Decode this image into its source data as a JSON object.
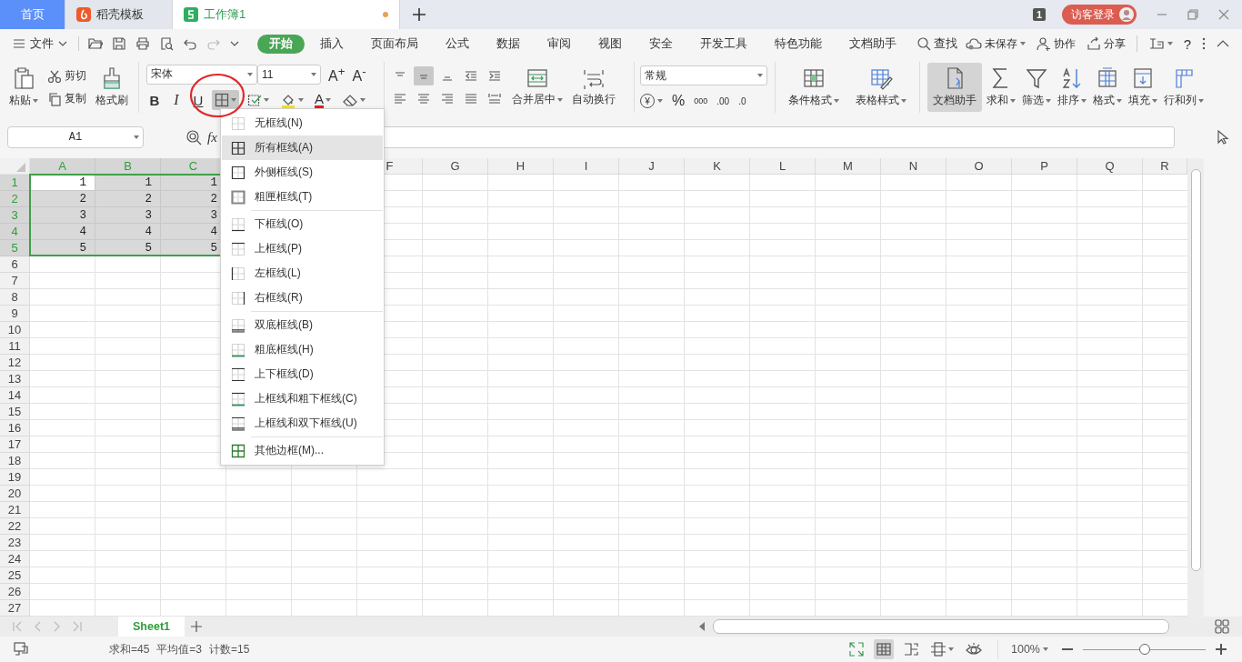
{
  "tab_bar": {
    "tabs": [
      {
        "label": "首页",
        "kind": "home",
        "selected": false,
        "modified": false
      },
      {
        "label": "稻壳模板",
        "kind": "docer",
        "selected": false,
        "modified": false
      },
      {
        "label": "工作簿1",
        "kind": "sheet",
        "selected": true,
        "modified": true
      }
    ],
    "window_count": "1",
    "login_button": "访客登录"
  },
  "menu_bar": {
    "file": "文件",
    "tabs": [
      {
        "label": "开始",
        "selected": true
      },
      {
        "label": "插入",
        "selected": false
      },
      {
        "label": "页面布局",
        "selected": false
      },
      {
        "label": "公式",
        "selected": false
      },
      {
        "label": "数据",
        "selected": false
      },
      {
        "label": "审阅",
        "selected": false
      },
      {
        "label": "视图",
        "selected": false
      },
      {
        "label": "安全",
        "selected": false
      },
      {
        "label": "开发工具",
        "selected": false
      },
      {
        "label": "特色功能",
        "selected": false
      },
      {
        "label": "文档助手",
        "selected": false
      }
    ],
    "search": "查找",
    "unsaved": "未保存",
    "collaborate": "协作",
    "share": "分享",
    "help": "?"
  },
  "ribbon": {
    "paste": "粘贴",
    "cut": "剪切",
    "copy": "复制",
    "format_painter": "格式刷",
    "font_name": "宋体",
    "font_size": "11",
    "grow_font": "A$^{+}$",
    "shrink_font": "A$^{-}$",
    "bold": "B",
    "italic": "I",
    "underline": "U",
    "font_color": "A",
    "border_menu_open": true,
    "align_buttons": [
      {
        "kind": "top",
        "selected": false
      },
      {
        "kind": "middle",
        "selected": true
      },
      {
        "kind": "bottom",
        "selected": false
      },
      {
        "kind": "outdent",
        "selected": false
      },
      {
        "kind": "indent",
        "selected": false
      },
      {
        "kind": "left",
        "selected": false
      },
      {
        "kind": "center",
        "selected": false
      },
      {
        "kind": "right",
        "selected": false
      },
      {
        "kind": "justify",
        "selected": false
      },
      {
        "kind": "distributed",
        "selected": false
      }
    ],
    "merge_center": "合并居中",
    "wrap_text": "自动换行",
    "number_format": "常规",
    "currency": "¥",
    "percent": "%",
    "thousands": "000",
    "add_decimal": ".00",
    "remove_decimal": ".0",
    "styles": [
      {
        "label": "条件格式",
        "kind": "conditional"
      },
      {
        "label": "表格样式",
        "kind": "table-style"
      }
    ],
    "tools": [
      {
        "label": "文档助手",
        "kind": "assistant",
        "selected": true
      },
      {
        "label": "求和",
        "kind": "sum",
        "selected": false
      },
      {
        "label": "筛选",
        "kind": "filter",
        "selected": false
      },
      {
        "label": "排序",
        "kind": "sort",
        "selected": false
      },
      {
        "label": "格式",
        "kind": "format",
        "selected": false
      },
      {
        "label": "填充",
        "kind": "fill",
        "selected": false
      },
      {
        "label": "行和列",
        "kind": "rowcol",
        "selected": false
      }
    ]
  },
  "formula_bar": {
    "cell_reference": "A1",
    "fx": "fx"
  },
  "sheet": {
    "column_groups": [
      [
        {
          "label": "A",
          "selected": true
        },
        {
          "label": "B",
          "selected": true
        },
        {
          "label": "C",
          "selected": true
        }
      ],
      [
        {
          "label": "F",
          "selected": false
        },
        {
          "label": "G",
          "selected": false
        },
        {
          "label": "H",
          "selected": false
        },
        {
          "label": "I",
          "selected": false
        },
        {
          "label": "J",
          "selected": false
        },
        {
          "label": "K",
          "selected": false
        },
        {
          "label": "L",
          "selected": false
        },
        {
          "label": "M",
          "selected": false
        },
        {
          "label": "N",
          "selected": false
        },
        {
          "label": "O",
          "selected": false
        },
        {
          "label": "P",
          "selected": false
        },
        {
          "label": "Q",
          "selected": false
        },
        {
          "label": "R",
          "selected": false
        }
      ]
    ],
    "rows": [
      {
        "label": "1",
        "selected": true,
        "cells": [
          {
            "value": "1",
            "active": true
          },
          {
            "value": "1",
            "active": false
          },
          {
            "value": "1",
            "active": false
          }
        ]
      },
      {
        "label": "2",
        "selected": true,
        "cells": [
          {
            "value": "2",
            "active": false
          },
          {
            "value": "2",
            "active": false
          },
          {
            "value": "2",
            "active": false
          }
        ]
      },
      {
        "label": "3",
        "selected": true,
        "cells": [
          {
            "value": "3",
            "active": false
          },
          {
            "value": "3",
            "active": false
          },
          {
            "value": "3",
            "active": false
          }
        ]
      },
      {
        "label": "4",
        "selected": true,
        "cells": [
          {
            "value": "4",
            "active": false
          },
          {
            "value": "4",
            "active": false
          },
          {
            "value": "4",
            "active": false
          }
        ]
      },
      {
        "label": "5",
        "selected": true,
        "cells": [
          {
            "value": "5",
            "active": false
          },
          {
            "value": "5",
            "active": false
          },
          {
            "value": "5",
            "active": false
          }
        ]
      },
      {
        "label": "6",
        "selected": false
      },
      {
        "label": "7",
        "selected": false
      },
      {
        "label": "8",
        "selected": false
      },
      {
        "label": "9",
        "selected": false
      },
      {
        "label": "10",
        "selected": false
      },
      {
        "label": "11",
        "selected": false
      },
      {
        "label": "12",
        "selected": false
      },
      {
        "label": "13",
        "selected": false
      },
      {
        "label": "14",
        "selected": false
      },
      {
        "label": "15",
        "selected": false
      },
      {
        "label": "16",
        "selected": false
      },
      {
        "label": "17",
        "selected": false
      },
      {
        "label": "18",
        "selected": false
      },
      {
        "label": "19",
        "selected": false
      },
      {
        "label": "20",
        "selected": false
      },
      {
        "label": "21",
        "selected": false
      },
      {
        "label": "22",
        "selected": false
      },
      {
        "label": "23",
        "selected": false
      },
      {
        "label": "24",
        "selected": false
      },
      {
        "label": "25",
        "selected": false
      },
      {
        "label": "26",
        "selected": false
      },
      {
        "label": "27",
        "selected": false
      }
    ]
  },
  "border_menu": {
    "groups": [
      [
        {
          "label": "无框线(N)",
          "kind": "none",
          "highlighted": false
        },
        {
          "label": "所有框线(A)",
          "kind": "all",
          "highlighted": true
        },
        {
          "label": "外侧框线(S)",
          "kind": "outside",
          "highlighted": false
        },
        {
          "label": "粗匣框线(T)",
          "kind": "thick-box",
          "highlighted": false
        }
      ],
      [
        {
          "label": "下框线(O)",
          "kind": "bottom",
          "highlighted": false
        },
        {
          "label": "上框线(P)",
          "kind": "top",
          "highlighted": false
        },
        {
          "label": "左框线(L)",
          "kind": "left",
          "highlighted": false
        },
        {
          "label": "右框线(R)",
          "kind": "right",
          "highlighted": false
        }
      ],
      [
        {
          "label": "双底框线(B)",
          "kind": "double-bottom",
          "highlighted": false
        },
        {
          "label": "粗底框线(H)",
          "kind": "thick-bottom",
          "highlighted": false
        },
        {
          "label": "上下框线(D)",
          "kind": "top-bottom",
          "highlighted": false
        },
        {
          "label": "上框线和粗下框线(C)",
          "kind": "top-thick-bottom",
          "highlighted": false
        },
        {
          "label": "上框线和双下框线(U)",
          "kind": "top-double-bottom",
          "highlighted": false
        }
      ],
      [
        {
          "label": "其他边框(M)...",
          "kind": "more",
          "highlighted": false
        }
      ]
    ]
  },
  "sheet_tabs": [
    {
      "label": "Sheet1",
      "selected": true
    }
  ],
  "status_bar": {
    "stats": [
      "求和=45",
      "平均值=3",
      "计数=15"
    ],
    "zoom": "100%",
    "zoom_slider": {
      "level": 0.5
    }
  }
}
